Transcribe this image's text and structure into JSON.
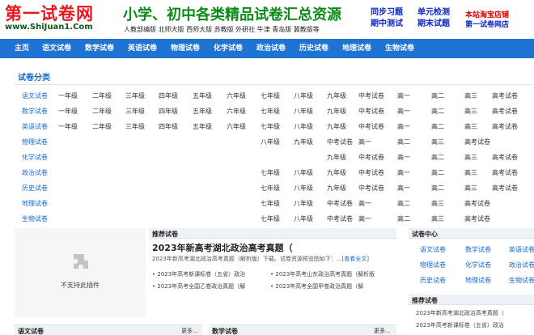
{
  "header": {
    "logo_main": "第一试卷网",
    "logo_url": "www.ShiJuan1.Com",
    "slogan": "小学、初中各类精品试卷汇总资源",
    "editions": "人教部编版  北师大版  西师大版  苏教版  外研社  牛津  青岛版  冀教版等",
    "links": [
      "同步习题",
      "单元检测",
      "期中测试",
      "期末试题"
    ],
    "shop_line1": "本站淘宝店铺",
    "shop_line2": "第一试卷网店"
  },
  "nav": [
    "主页",
    "语文试卷",
    "数学试卷",
    "英语试卷",
    "物理试卷",
    "化学试卷",
    "政治试卷",
    "历史试卷",
    "地理试卷",
    "生物试卷"
  ],
  "categories": {
    "title": "试卷分类",
    "rows": [
      {
        "label": "语文试卷",
        "items": [
          "一年级",
          "二年级",
          "三年级",
          "四年级",
          "五年级",
          "六年级",
          "七年级",
          "八年级",
          "九年级",
          "中考试卷",
          "高一",
          "高二",
          "高三",
          "高考试卷"
        ]
      },
      {
        "label": "数学试卷",
        "items": [
          "一年级",
          "二年级",
          "三年级",
          "四年级",
          "五年级",
          "六年级",
          "七年级",
          "八年级",
          "九年级",
          "中考试卷",
          "高一",
          "高二",
          "高三",
          "高考试卷"
        ]
      },
      {
        "label": "英语试卷",
        "items": [
          "一年级",
          "二年级",
          "三年级",
          "四年级",
          "五年级",
          "六年级",
          "七年级",
          "八年级",
          "九年级",
          "中考试卷",
          "高一",
          "高二",
          "高三",
          "高考试卷"
        ]
      },
      {
        "label": "物理试卷",
        "items": [
          "八年级",
          "九年级",
          "中考试卷",
          "高一",
          "高二",
          "高三",
          "高考试卷"
        ]
      },
      {
        "label": "化学试卷",
        "items": [
          "九年级",
          "中考试卷",
          "高一",
          "高二",
          "高三",
          "高考试卷"
        ]
      },
      {
        "label": "政治试卷",
        "items": [
          "七年级",
          "八年级",
          "九年级",
          "中考试卷",
          "高一",
          "高二",
          "高三",
          "高考试卷"
        ]
      },
      {
        "label": "历史试卷",
        "items": [
          "七年级",
          "八年级",
          "九年级",
          "中考试卷",
          "高一",
          "高二",
          "高三",
          "高考试卷"
        ]
      },
      {
        "label": "地理试卷",
        "items": [
          "七年级",
          "八年级",
          "中考试卷",
          "高一",
          "高二",
          "高三",
          "高考试卷"
        ]
      },
      {
        "label": "生物试卷",
        "items": [
          "七年级",
          "八年级",
          "中考试卷",
          "高一",
          "高二",
          "高三",
          "高考试卷"
        ]
      }
    ]
  },
  "plugin": {
    "text": "不支持此插件"
  },
  "recommend": {
    "heading": "推荐试卷",
    "title": "2023年新高考湖北政治高考真题（",
    "summary": "2023年新高考湖北政治高考真题（解析版）下载。试卷资源预览图如下：...",
    "summary_more": "[查看全文]",
    "items": [
      "2023年高考新课标卷（五省）政治",
      "2023年高考山东政治高考真题（解析版",
      "2023年高考全国乙卷政治真题（解",
      "2023年高考全国甲卷政治真题（解"
    ]
  },
  "sidebar": {
    "center_heading": "试卷中心",
    "center_items": [
      "语文试卷",
      "数学试卷",
      "英语试卷",
      "物理试卷",
      "化学试卷",
      "政治试卷",
      "历史试卷",
      "地理试卷",
      "生物试卷"
    ],
    "rec_heading": "推荐试卷",
    "rec_items": [
      "2023年新高考湖北政治高考真题（",
      "2023年高考新课标卷（五省）政治"
    ]
  },
  "bottom": [
    {
      "title": "语文试卷",
      "more": "更多..."
    },
    {
      "title": "数学试卷",
      "more": "更多..."
    }
  ],
  "colors": {
    "nav_bg": "#1f73d3",
    "logo_red": "#e8161f",
    "slogan_green": "#0c8a18",
    "link_blue": "#1668c8"
  }
}
